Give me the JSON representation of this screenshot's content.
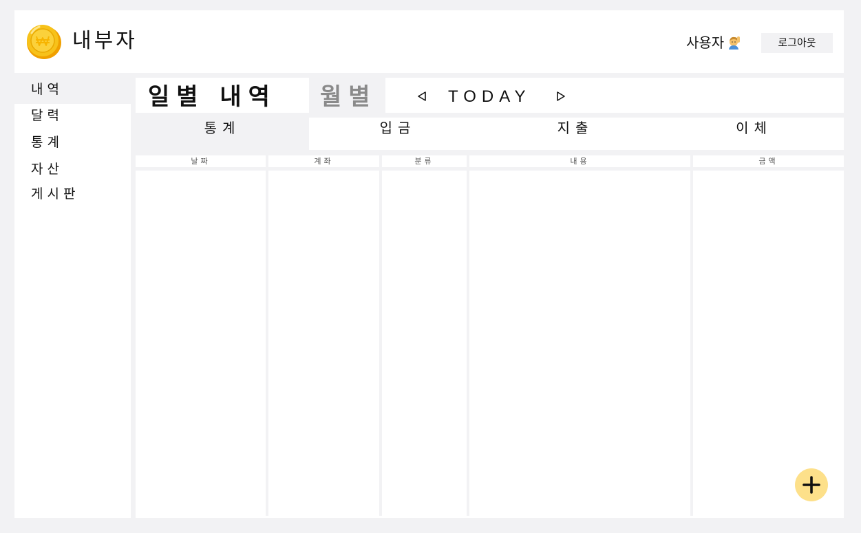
{
  "header": {
    "app_title": "내부자",
    "user_label": "사용자",
    "logout_label": "로그아웃"
  },
  "sidebar": {
    "items": [
      {
        "label": "내역"
      },
      {
        "label": "달력"
      },
      {
        "label": "통계"
      },
      {
        "label": "자산"
      },
      {
        "label": "게시판"
      }
    ]
  },
  "view": {
    "daily_label": "일별 내역",
    "monthly_label": "월별",
    "today_label": "TODAY"
  },
  "tabs": [
    {
      "label": "통계"
    },
    {
      "label": "입금"
    },
    {
      "label": "지출"
    },
    {
      "label": "이체"
    }
  ],
  "table": {
    "columns": [
      "날짜",
      "계좌",
      "분류",
      "내용",
      "금액"
    ]
  },
  "icons": {
    "logo": "coin-won-icon",
    "user": "person-raising-hand-icon",
    "prev": "triangle-left-icon",
    "next": "triangle-right-icon",
    "add": "plus-icon"
  },
  "colors": {
    "background": "#f2f2f4",
    "panel": "#ffffff",
    "coin": "#f5b400",
    "add_button": "#fde08a",
    "muted_text": "#8a8a8a"
  }
}
